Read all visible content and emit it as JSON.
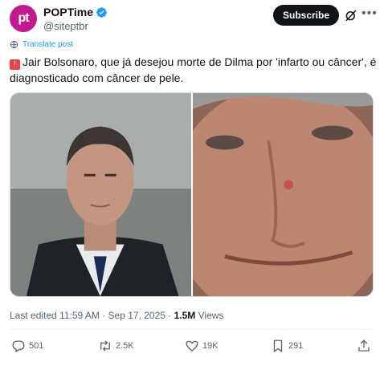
{
  "author": {
    "display_name": "POPTime",
    "handle": "@siteptbr",
    "avatar_text": "pt",
    "avatar_color": "#c21a8e"
  },
  "header": {
    "subscribe_label": "Subscribe"
  },
  "translate_label": "Translate post",
  "tweet": {
    "emoji": "🚨",
    "text": "Jair Bolsonaro, que já desejou morte de Dilma por 'infarto ou câncer', é diagnosticado com câncer de pele."
  },
  "meta": {
    "edited": "Last edited 11:59 AM · Sep 17, 2025 ·",
    "views_count": "1.5M",
    "views_label": "Views"
  },
  "actions": {
    "replies": "501",
    "reposts": "2.5K",
    "likes": "19K",
    "bookmarks": "291"
  },
  "colors": {
    "accent": "#1d9bf0",
    "text": "#0f1419",
    "secondary": "#536471"
  }
}
